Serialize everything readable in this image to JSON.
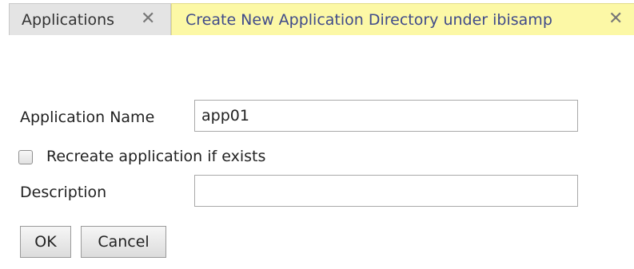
{
  "tabs": [
    {
      "label": "Applications",
      "close_glyph": "✕",
      "close_icon": "close-icon"
    },
    {
      "label": "Create New Application Directory under ibisamp",
      "close_glyph": "✕",
      "close_icon": "close-icon",
      "active_color": "#fcf8a6"
    }
  ],
  "form": {
    "app_name_label": "Application Name",
    "app_name_value": "app01",
    "recreate_label": "Recreate application if exists",
    "recreate_checked": false,
    "description_label": "Description",
    "description_value": "",
    "ok_label": "OK",
    "cancel_label": "Cancel"
  }
}
